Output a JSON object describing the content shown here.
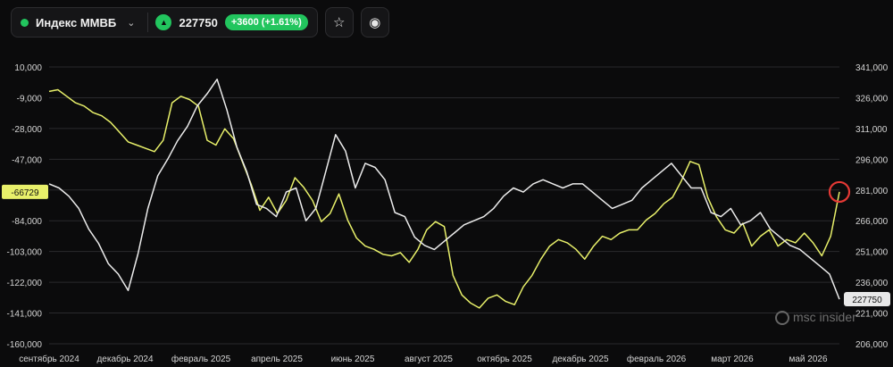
{
  "header": {
    "instrument_name": "Индекс ММВБ",
    "chevron_icon": "chevron-down-icon",
    "trend_icon": "triangle-up-icon",
    "price": "227750",
    "change": "+3600 (+1.61%)",
    "favorite_icon": "star-icon",
    "visibility_icon": "eye-icon"
  },
  "colors": {
    "background": "#0b0b0c",
    "yellow_series": "#e8f06a",
    "white_series": "#ececec",
    "accent_green": "#22c55e",
    "highlight_label": "#e8f06a",
    "marker_circle": "#e53935"
  },
  "watermark": "msc insider",
  "chart_data": {
    "type": "line",
    "x_tick_labels": [
      "сентябрь 2024",
      "декабрь 2024",
      "февраль 2025",
      "апрель 2025",
      "июнь 2025",
      "август 2025",
      "октябрь 2025",
      "декабрь 2025",
      "февраль 2026",
      "март 2026",
      "май 2026"
    ],
    "left_axis": {
      "ticks": [
        "10,000",
        "-9,000",
        "-28,000",
        "-47,000",
        "-66,000",
        "-84,000",
        "-103,000",
        "-122,000",
        "-141,000",
        "-160,000"
      ],
      "range": [
        -160000,
        10000
      ],
      "current_label": "-66729"
    },
    "right_axis": {
      "ticks": [
        "341,000",
        "326,000",
        "311,000",
        "296,000",
        "281,000",
        "266,000",
        "251,000",
        "236,000",
        "221,000",
        "206,000"
      ],
      "range": [
        206000,
        341000
      ],
      "current_label": "227750"
    },
    "series": [
      {
        "axis": "left",
        "color": "#e8f06a",
        "values": [
          -5000,
          -4000,
          -8000,
          -12000,
          -14000,
          -18000,
          -20000,
          -24000,
          -30000,
          -36000,
          -38000,
          -40000,
          -42000,
          -35000,
          -12000,
          -8000,
          -10000,
          -14000,
          -35000,
          -38000,
          -28000,
          -34000,
          -48000,
          -62000,
          -78000,
          -70000,
          -80000,
          -72000,
          -58000,
          -64000,
          -72000,
          -85000,
          -80000,
          -68000,
          -84000,
          -95000,
          -100000,
          -102000,
          -105000,
          -106000,
          -104000,
          -110000,
          -102000,
          -90000,
          -85000,
          -88000,
          -118000,
          -130000,
          -135000,
          -138000,
          -132000,
          -130000,
          -134000,
          -136000,
          -125000,
          -118000,
          -108000,
          -100000,
          -96000,
          -98000,
          -102000,
          -108000,
          -100000,
          -94000,
          -96000,
          -92000,
          -90000,
          -90000,
          -84000,
          -80000,
          -74000,
          -70000,
          -60000,
          -48000,
          -50000,
          -70000,
          -82000,
          -90000,
          -92000,
          -86000,
          -100000,
          -94000,
          -90000,
          -100000,
          -96000,
          -98000,
          -92000,
          -98000,
          -106000,
          -94000,
          -66729
        ]
      },
      {
        "axis": "right",
        "color": "#ececec",
        "values": [
          284000,
          282000,
          278000,
          272000,
          262000,
          255000,
          245000,
          240000,
          232000,
          250000,
          272000,
          288000,
          296000,
          305000,
          312000,
          322000,
          328000,
          335000,
          320000,
          302000,
          290000,
          274000,
          272000,
          268000,
          280000,
          282000,
          266000,
          272000,
          290000,
          308000,
          300000,
          282000,
          294000,
          292000,
          286000,
          270000,
          268000,
          258000,
          254000,
          252000,
          256000,
          260000,
          264000,
          266000,
          268000,
          272000,
          278000,
          282000,
          280000,
          284000,
          286000,
          284000,
          282000,
          284000,
          284000,
          280000,
          276000,
          272000,
          274000,
          276000,
          282000,
          286000,
          290000,
          294000,
          288000,
          282000,
          282000,
          270000,
          268000,
          272000,
          264000,
          266000,
          270000,
          262000,
          258000,
          254000,
          252000,
          248000,
          244000,
          240000,
          227750
        ]
      }
    ],
    "marker": {
      "series": 0,
      "index": 90
    },
    "grid": true
  }
}
